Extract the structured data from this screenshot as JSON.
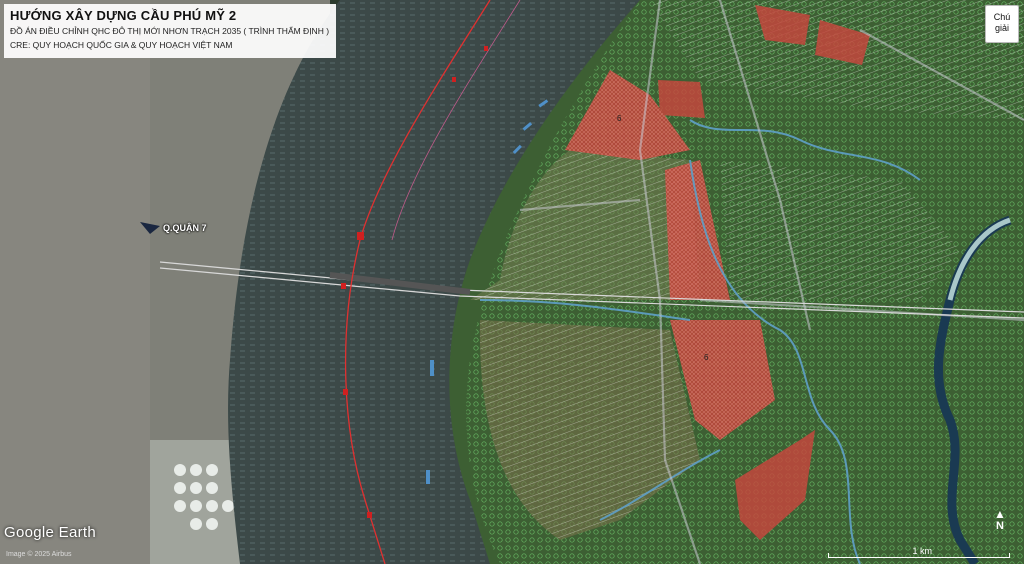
{
  "title": {
    "main": "HƯỚNG XÂY DỰNG CẦU PHÚ MỸ 2",
    "line1": "ĐỒ ÁN ĐIỀU CHỈNH QHC ĐÔ THỊ MỚI NHƠN TRẠCH 2035 ( TRÌNH THẨM ĐỊNH )",
    "line2": "CRE: QUY HOẠCH QUỐC GIA & QUY HOẠCH VIỆT NAM"
  },
  "legend_button": {
    "line1": "Chú",
    "line2": "giải"
  },
  "labels": {
    "district": "Q.QUẬN 7",
    "zone_a": "6",
    "zone_b": "6"
  },
  "footer": {
    "brand": "Google Earth",
    "credit": "Image © 2025 Airbus"
  },
  "scale": {
    "label": "1 km"
  },
  "north": {
    "label": "N"
  },
  "colors": {
    "river": "#3d4a4a",
    "land_urban": "#8a8a80",
    "land_green": "#3f6a34",
    "plan_green": "#2f8a3a",
    "plan_red": "#c8463d",
    "route_line": "#e03030",
    "channel": "#5fa0c8"
  },
  "icons": [
    "north-arrow-icon"
  ]
}
